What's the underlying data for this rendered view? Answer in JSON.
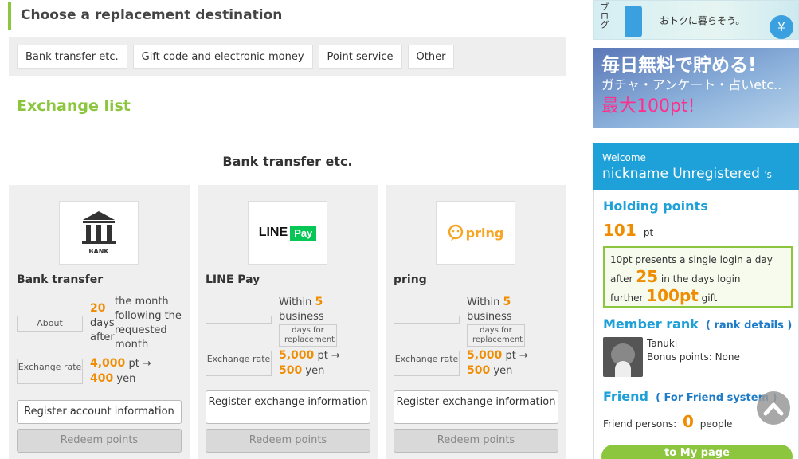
{
  "destination": {
    "title": "Choose a replacement destination",
    "buttons": [
      "Bank transfer etc.",
      "Gift code and electronic money",
      "Point service",
      "Other"
    ]
  },
  "exchange": {
    "title": "Exchange list",
    "section": "Bank transfer etc."
  },
  "cards": [
    {
      "name": "Bank transfer",
      "logo_text": "BANK",
      "about_label": "About",
      "about_num": "20",
      "about_unit": "days after",
      "about_rest": "the month following the requested month",
      "rate_label": "Exchange rate",
      "rate_pt": "4,000",
      "rate_pt_unit": "pt →",
      "rate_yen": "400",
      "rate_yen_unit": "yen",
      "register": "Register account information",
      "redeem": "Redeem points"
    },
    {
      "name": "LINE Pay",
      "logo_text": "LINE",
      "logo_badge": "Pay",
      "within": "Within",
      "days_num": "5",
      "business": "business",
      "days_box": "days for replacement",
      "rate_label": "Exchange rate",
      "rate_pt": "5,000",
      "rate_pt_unit": "pt →",
      "rate_yen": "500",
      "rate_yen_unit": "yen",
      "register": "Register exchange information",
      "redeem": "Redeem points"
    },
    {
      "name": "pring",
      "logo_text": "pring",
      "within": "Within",
      "days_num": "5",
      "business": "business",
      "days_box": "days for replacement",
      "rate_label": "Exchange rate",
      "rate_pt": "5,000",
      "rate_pt_unit": "pt →",
      "rate_yen": "500",
      "rate_yen_unit": "yen",
      "register": "Register exchange information",
      "redeem": "Redeem points"
    }
  ],
  "sidebar": {
    "banner1_text": "おトクに暮らそう。",
    "banner1_vertical": "ブログ",
    "banner2": {
      "line1": "毎日無料で貯める!",
      "line2": "ガチャ・アンケート・占いetc..",
      "line3": "最大100pt!"
    },
    "welcome": "Welcome",
    "nickname": "nickname Unregistered",
    "nickname_suffix": "'s",
    "holding_title": "Holding points",
    "points": "101",
    "points_unit": "pt",
    "gift_line1": "10pt presents a single login a day",
    "gift_after": "after",
    "gift_days": "25",
    "gift_in": "in the days login",
    "gift_further": "further",
    "gift_bonus": "100pt",
    "gift_word": "gift",
    "rank_title": "Member rank",
    "rank_link": "( rank details )",
    "rank_name": "Tanuki",
    "rank_bonus": "Bonus points: None",
    "friend_title": "Friend",
    "friend_link": "( For Friend system )",
    "friend_label": "Friend persons:",
    "friend_count": "0",
    "friend_unit": "people",
    "mypage": "to My page"
  },
  "colors": {
    "green": "#8cc63f",
    "blue": "#1ea0d8",
    "orange": "#f08c00",
    "pink": "#ff2f8c"
  }
}
